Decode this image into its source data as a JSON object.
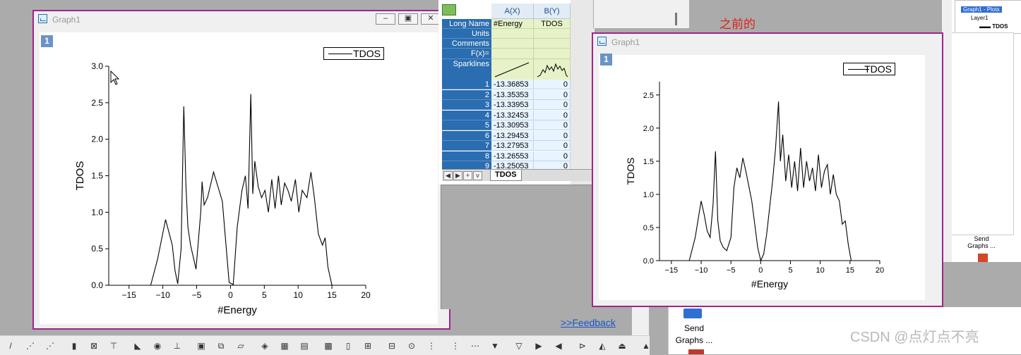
{
  "graph_left": {
    "title": "Graph1",
    "layer": "1",
    "legend": "TDOS",
    "xlabel": "#Energy",
    "ylabel": "TDOS",
    "xticks": [
      "−15",
      "−10",
      "−5",
      "0",
      "5",
      "10",
      "15",
      "20"
    ],
    "yticks": [
      "3.0",
      "2.5",
      "2.0",
      "1.5",
      "1.0",
      "0.5",
      "0.0"
    ]
  },
  "graph_right": {
    "title": "Graph1",
    "layer": "1",
    "legend": "TDOS",
    "xlabel": "#Energy",
    "ylabel": "TDOS",
    "xticks": [
      "−15",
      "−10",
      "−5",
      "0",
      "5",
      "10",
      "15",
      "20"
    ],
    "yticks": [
      "2.5",
      "2.0",
      "1.5",
      "1.0",
      "0.5",
      "0.0"
    ]
  },
  "worksheet": {
    "col_headers": [
      "A(X)",
      "B(Y)"
    ],
    "row_labels": [
      "Long Name",
      "Units",
      "Comments",
      "F(x)=",
      "Sparklines"
    ],
    "long_names": [
      "#Energy",
      "TDOS"
    ],
    "rows": [
      {
        "n": "1",
        "x": "-13.36853",
        "y": "0"
      },
      {
        "n": "2",
        "x": "-13.35353",
        "y": "0"
      },
      {
        "n": "3",
        "x": "-13.33953",
        "y": "0"
      },
      {
        "n": "4",
        "x": "-13.32453",
        "y": "0"
      },
      {
        "n": "5",
        "x": "-13.30953",
        "y": "0"
      },
      {
        "n": "6",
        "x": "-13.29453",
        "y": "0"
      },
      {
        "n": "7",
        "x": "-13.27953",
        "y": "0"
      },
      {
        "n": "8",
        "x": "-13.26553",
        "y": "0"
      },
      {
        "n": "9",
        "x": "-13.25053",
        "y": "0"
      }
    ],
    "sheet_tab": "TDOS"
  },
  "annotation_before": "之前的",
  "feedback_link": ">>Feedback",
  "send_graphs": "Send Graphs ...",
  "send_graphs_small": "Send Graphs ...",
  "object_manager": {
    "graph_item": "Graph1 - Plots",
    "layer_item": "Layer1",
    "plot_item": "TDOS"
  },
  "watermark": "CSDN @点灯点不亮",
  "colors": {
    "window_border": "#a0248c",
    "accent_red": "#e0201a",
    "link_blue": "#1a56c8"
  },
  "chart_data": [
    {
      "type": "line",
      "title": "",
      "xlabel": "#Energy",
      "ylabel": "TDOS",
      "xlim": [
        -18,
        20
      ],
      "ylim": [
        0,
        3.0
      ],
      "series": [
        {
          "name": "TDOS",
          "x": [
            -13,
            -11.8,
            -10.8,
            -9.6,
            -8.6,
            -8.2,
            -7.8,
            -7.3,
            -6.9,
            -6.6,
            -6.3,
            -5.9,
            -5.1,
            -4.4,
            -4.2,
            -3.9,
            -3.4,
            -2.5,
            -1.2,
            -0.2,
            0.4,
            1.0,
            1.7,
            2.2,
            2.6,
            3.0,
            3.3,
            3.6,
            4.1,
            4.6,
            5.1,
            5.6,
            6.1,
            6.6,
            7.1,
            7.5,
            8.0,
            8.5,
            9.0,
            9.6,
            10.1,
            10.6,
            11.3,
            11.9,
            12.4,
            13.0,
            13.6,
            14.0,
            14.4,
            15.0,
            15.6,
            16.3
          ],
          "y": [
            0,
            0,
            0.35,
            0.9,
            0.55,
            0.2,
            0.02,
            0.5,
            2.45,
            1.4,
            0.8,
            0.55,
            0.22,
            1.0,
            1.42,
            1.1,
            1.2,
            1.55,
            1.15,
            0.04,
            0.01,
            0.8,
            1.3,
            1.5,
            1.05,
            2.62,
            1.25,
            1.7,
            1.35,
            1.2,
            1.3,
            1.0,
            1.45,
            1.05,
            1.5,
            1.1,
            1.4,
            1.3,
            1.15,
            1.45,
            1.0,
            1.3,
            1.2,
            1.55,
            1.2,
            0.7,
            0.55,
            0.65,
            0.25,
            0,
            0,
            0
          ]
        }
      ]
    },
    {
      "type": "line",
      "title": "",
      "xlabel": "#Energy",
      "ylabel": "TDOS",
      "xlim": [
        -17,
        20
      ],
      "ylim": [
        0,
        2.7
      ],
      "series": [
        {
          "name": "TDOS",
          "x": [
            -13,
            -12,
            -11,
            -10,
            -9.5,
            -9,
            -8.5,
            -8,
            -7.6,
            -7.2,
            -6.8,
            -6.3,
            -5.7,
            -5,
            -4.5,
            -4,
            -3.5,
            -3,
            -2.5,
            -1.5,
            -0.5,
            0,
            0.5,
            1.0,
            1.5,
            2,
            2.5,
            3,
            3.3,
            3.7,
            4.2,
            4.7,
            5.2,
            5.7,
            6.2,
            6.7,
            7.2,
            7.7,
            8.2,
            8.7,
            9.2,
            9.7,
            10.2,
            10.7,
            11.2,
            11.7,
            12.2,
            12.7,
            13.2,
            13.7,
            14.2,
            14.7,
            15.2,
            16
          ],
          "y": [
            0,
            0,
            0.35,
            0.9,
            0.7,
            0.45,
            0.35,
            0.85,
            1.65,
            0.6,
            0.3,
            0.2,
            0.15,
            0.35,
            1.1,
            1.4,
            1.25,
            1.55,
            1.35,
            0.9,
            0.2,
            0,
            0.1,
            0.4,
            0.8,
            1.2,
            1.7,
            2.4,
            1.5,
            1.9,
            1.2,
            1.6,
            1.1,
            1.5,
            1.05,
            1.7,
            1.1,
            1.5,
            1.2,
            1.4,
            1.05,
            1.6,
            1.1,
            1.35,
            1.45,
            1.0,
            1.3,
            1.0,
            0.9,
            0.55,
            0.6,
            0.25,
            0,
            0
          ]
        }
      ]
    }
  ]
}
